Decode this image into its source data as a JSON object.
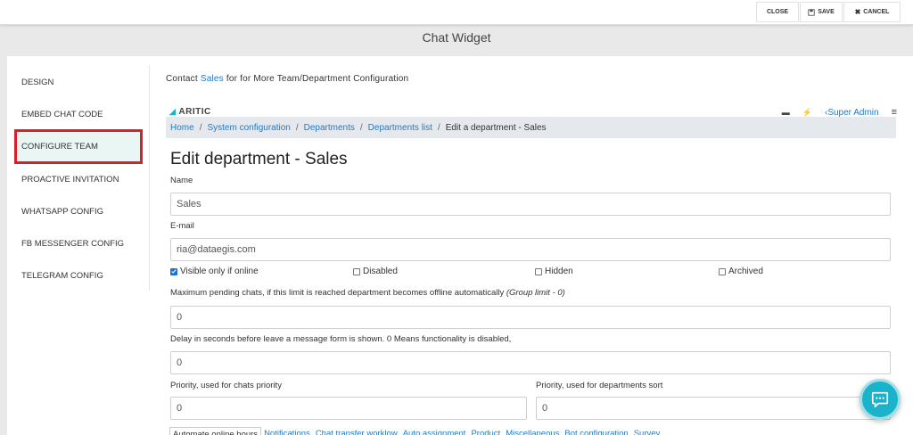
{
  "toolbar": {
    "close_label": "CLOSE",
    "save_label": "SAVE",
    "cancel_label": "CANCEL"
  },
  "page_title": "Chat Widget",
  "sidebar": {
    "items": [
      {
        "label": "DESIGN"
      },
      {
        "label": "EMBED CHAT CODE"
      },
      {
        "label": "CONFIGURE TEAM"
      },
      {
        "label": "PROACTIVE INVITATION"
      },
      {
        "label": "WHATSAPP CONFIG"
      },
      {
        "label": "FB MESSENGER CONFIG"
      },
      {
        "label": "TELEGRAM CONFIG"
      }
    ],
    "selected": "CONFIGURE TEAM"
  },
  "contact": {
    "prefix": "Contact",
    "link": "Sales",
    "suffix": "for for More Team/Department Configuration"
  },
  "app_header": {
    "logo_text": "ARITIC",
    "user_label": "Super Admin",
    "icons": [
      "message-icon",
      "flash-icon",
      "user-icon",
      "menu-icon"
    ]
  },
  "breadcrumb": {
    "items": [
      "Home",
      "System configuration",
      "Departments",
      "Departments list"
    ],
    "current": "Edit a department - Sales",
    "separator": "/"
  },
  "form": {
    "heading": "Edit department - Sales",
    "name_label": "Name",
    "name_value": "Sales",
    "email_label": "E-mail",
    "email_value": "ria@dataegis.com",
    "checkboxes": [
      {
        "label": "Visible only if online",
        "checked": true
      },
      {
        "label": "Disabled",
        "checked": false
      },
      {
        "label": "Hidden",
        "checked": false
      },
      {
        "label": "Archived",
        "checked": false
      }
    ],
    "max_pending_label": "Maximum pending chats, if this limit is reached department becomes offline automatically",
    "max_pending_hint": "(Group limit - 0)",
    "max_pending_value": "0",
    "delay_label": "Delay in seconds before leave a message form is shown. 0 Means functionality is disabled,",
    "delay_value": "0",
    "priority_label": "Priority, used for chats priority",
    "priority_value": "0",
    "sort_priority_label": "Priority, used for departments sort",
    "sort_priority_value": "0"
  },
  "tabs": [
    "Automate online hours",
    "Notifications",
    "Chat transfer worklow",
    "Auto assignment",
    "Product",
    "Miscellaneous",
    "Bot configuration",
    "Survey"
  ],
  "colors": {
    "accent": "#1f7ac7",
    "highlight_border": "#d6202a",
    "chat_button": "#1bb3c9"
  }
}
